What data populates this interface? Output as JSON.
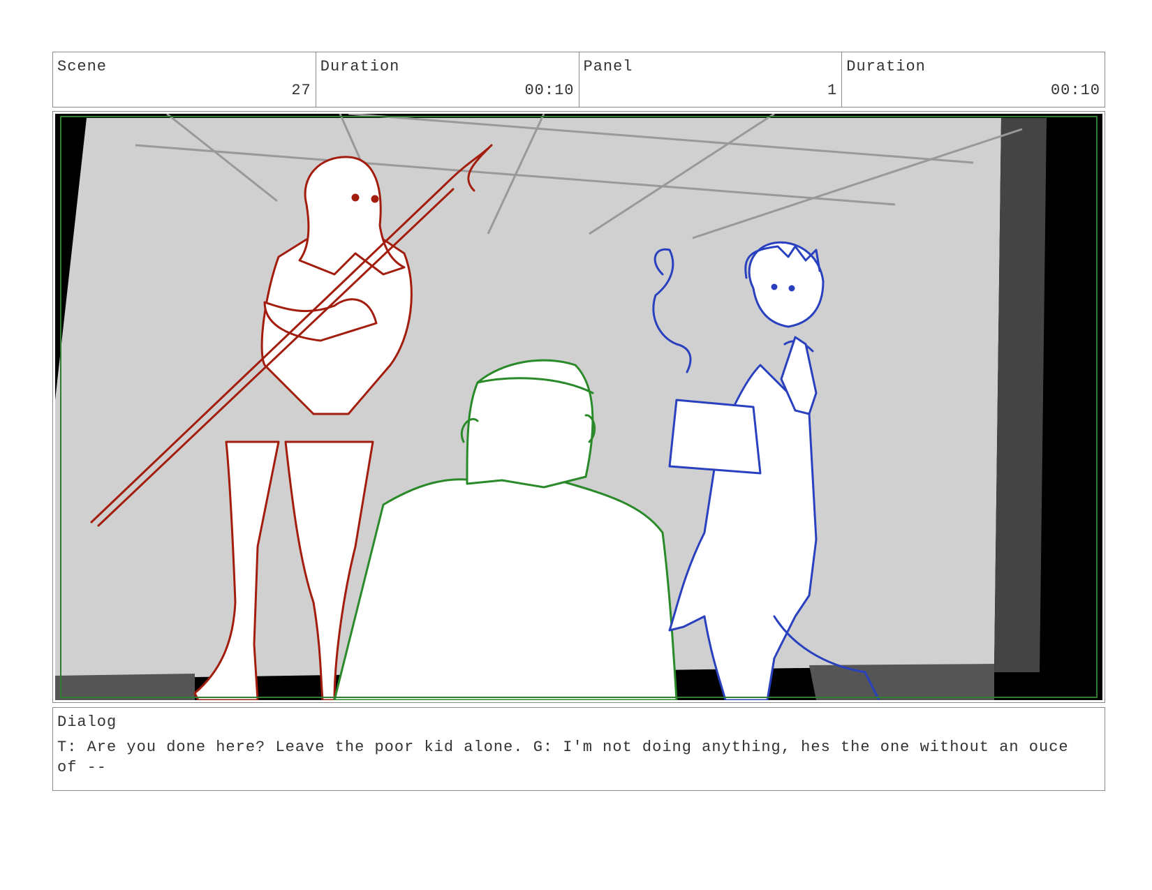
{
  "header": {
    "scene_label": "Scene",
    "scene_value": "27",
    "scene_duration_label": "Duration",
    "scene_duration_value": "00:10",
    "panel_label": "Panel",
    "panel_value": "1",
    "panel_duration_label": "Duration",
    "panel_duration_value": "00:10"
  },
  "panel": {
    "background_color": "#d0d0d0",
    "frame_guide_color": "#2e7d32",
    "character_colors": {
      "left": "#a31d0e",
      "center": "#2a8a2a",
      "right": "#2940bf"
    }
  },
  "dialog": {
    "label": "Dialog",
    "text": "T: Are you done here? Leave the poor kid alone. G: I'm not doing anything, hes the one without an ouce of --"
  }
}
